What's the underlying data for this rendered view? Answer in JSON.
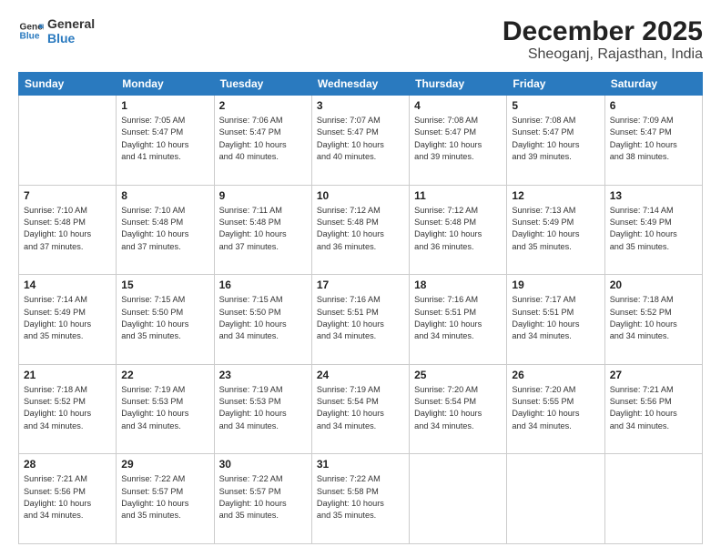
{
  "header": {
    "logo_line1": "General",
    "logo_line2": "Blue",
    "month": "December 2025",
    "location": "Sheoganj, Rajasthan, India"
  },
  "weekdays": [
    "Sunday",
    "Monday",
    "Tuesday",
    "Wednesday",
    "Thursday",
    "Friday",
    "Saturday"
  ],
  "weeks": [
    [
      {
        "day": "",
        "info": ""
      },
      {
        "day": "1",
        "info": "Sunrise: 7:05 AM\nSunset: 5:47 PM\nDaylight: 10 hours\nand 41 minutes."
      },
      {
        "day": "2",
        "info": "Sunrise: 7:06 AM\nSunset: 5:47 PM\nDaylight: 10 hours\nand 40 minutes."
      },
      {
        "day": "3",
        "info": "Sunrise: 7:07 AM\nSunset: 5:47 PM\nDaylight: 10 hours\nand 40 minutes."
      },
      {
        "day": "4",
        "info": "Sunrise: 7:08 AM\nSunset: 5:47 PM\nDaylight: 10 hours\nand 39 minutes."
      },
      {
        "day": "5",
        "info": "Sunrise: 7:08 AM\nSunset: 5:47 PM\nDaylight: 10 hours\nand 39 minutes."
      },
      {
        "day": "6",
        "info": "Sunrise: 7:09 AM\nSunset: 5:47 PM\nDaylight: 10 hours\nand 38 minutes."
      }
    ],
    [
      {
        "day": "7",
        "info": "Sunrise: 7:10 AM\nSunset: 5:48 PM\nDaylight: 10 hours\nand 37 minutes."
      },
      {
        "day": "8",
        "info": "Sunrise: 7:10 AM\nSunset: 5:48 PM\nDaylight: 10 hours\nand 37 minutes."
      },
      {
        "day": "9",
        "info": "Sunrise: 7:11 AM\nSunset: 5:48 PM\nDaylight: 10 hours\nand 37 minutes."
      },
      {
        "day": "10",
        "info": "Sunrise: 7:12 AM\nSunset: 5:48 PM\nDaylight: 10 hours\nand 36 minutes."
      },
      {
        "day": "11",
        "info": "Sunrise: 7:12 AM\nSunset: 5:48 PM\nDaylight: 10 hours\nand 36 minutes."
      },
      {
        "day": "12",
        "info": "Sunrise: 7:13 AM\nSunset: 5:49 PM\nDaylight: 10 hours\nand 35 minutes."
      },
      {
        "day": "13",
        "info": "Sunrise: 7:14 AM\nSunset: 5:49 PM\nDaylight: 10 hours\nand 35 minutes."
      }
    ],
    [
      {
        "day": "14",
        "info": "Sunrise: 7:14 AM\nSunset: 5:49 PM\nDaylight: 10 hours\nand 35 minutes."
      },
      {
        "day": "15",
        "info": "Sunrise: 7:15 AM\nSunset: 5:50 PM\nDaylight: 10 hours\nand 35 minutes."
      },
      {
        "day": "16",
        "info": "Sunrise: 7:15 AM\nSunset: 5:50 PM\nDaylight: 10 hours\nand 34 minutes."
      },
      {
        "day": "17",
        "info": "Sunrise: 7:16 AM\nSunset: 5:51 PM\nDaylight: 10 hours\nand 34 minutes."
      },
      {
        "day": "18",
        "info": "Sunrise: 7:16 AM\nSunset: 5:51 PM\nDaylight: 10 hours\nand 34 minutes."
      },
      {
        "day": "19",
        "info": "Sunrise: 7:17 AM\nSunset: 5:51 PM\nDaylight: 10 hours\nand 34 minutes."
      },
      {
        "day": "20",
        "info": "Sunrise: 7:18 AM\nSunset: 5:52 PM\nDaylight: 10 hours\nand 34 minutes."
      }
    ],
    [
      {
        "day": "21",
        "info": "Sunrise: 7:18 AM\nSunset: 5:52 PM\nDaylight: 10 hours\nand 34 minutes."
      },
      {
        "day": "22",
        "info": "Sunrise: 7:19 AM\nSunset: 5:53 PM\nDaylight: 10 hours\nand 34 minutes."
      },
      {
        "day": "23",
        "info": "Sunrise: 7:19 AM\nSunset: 5:53 PM\nDaylight: 10 hours\nand 34 minutes."
      },
      {
        "day": "24",
        "info": "Sunrise: 7:19 AM\nSunset: 5:54 PM\nDaylight: 10 hours\nand 34 minutes."
      },
      {
        "day": "25",
        "info": "Sunrise: 7:20 AM\nSunset: 5:54 PM\nDaylight: 10 hours\nand 34 minutes."
      },
      {
        "day": "26",
        "info": "Sunrise: 7:20 AM\nSunset: 5:55 PM\nDaylight: 10 hours\nand 34 minutes."
      },
      {
        "day": "27",
        "info": "Sunrise: 7:21 AM\nSunset: 5:56 PM\nDaylight: 10 hours\nand 34 minutes."
      }
    ],
    [
      {
        "day": "28",
        "info": "Sunrise: 7:21 AM\nSunset: 5:56 PM\nDaylight: 10 hours\nand 34 minutes."
      },
      {
        "day": "29",
        "info": "Sunrise: 7:22 AM\nSunset: 5:57 PM\nDaylight: 10 hours\nand 35 minutes."
      },
      {
        "day": "30",
        "info": "Sunrise: 7:22 AM\nSunset: 5:57 PM\nDaylight: 10 hours\nand 35 minutes."
      },
      {
        "day": "31",
        "info": "Sunrise: 7:22 AM\nSunset: 5:58 PM\nDaylight: 10 hours\nand 35 minutes."
      },
      {
        "day": "",
        "info": ""
      },
      {
        "day": "",
        "info": ""
      },
      {
        "day": "",
        "info": ""
      }
    ]
  ]
}
